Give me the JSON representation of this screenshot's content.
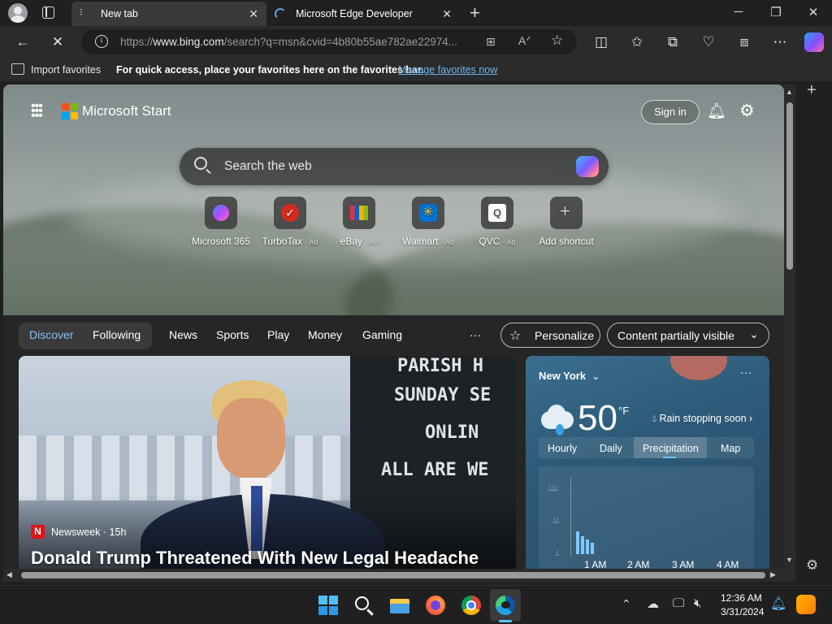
{
  "browser": {
    "tabs": [
      {
        "title": "New tab"
      },
      {
        "title": "Microsoft Edge Developer"
      }
    ],
    "address_bar": {
      "url_prefix": "https://",
      "url_domain": "www.bing.com",
      "url_rest": "/search?q=msn&cvid=4b80b55ae782",
      "url_tail": "ae22974..."
    },
    "favorites_bar": {
      "import_label": "Import favorites",
      "message": "For quick access, place your favorites here on the favorites bar.",
      "manage_link": "Manage favorites now"
    }
  },
  "page": {
    "brand": "Microsoft Start",
    "sign_in": "Sign in",
    "search_placeholder": "Search the web",
    "quick_links": [
      {
        "label": "Microsoft 365",
        "ad": ""
      },
      {
        "label": "TurboTax",
        "ad": "· Ad"
      },
      {
        "label": "eBay",
        "ad": "· Ad"
      },
      {
        "label": "Walmart",
        "ad": "· Ad"
      },
      {
        "label": "QVC",
        "ad": "· Ad"
      },
      {
        "label": "Add shortcut",
        "ad": ""
      }
    ],
    "feed_nav": {
      "discover": "Discover",
      "following": "Following",
      "items": [
        "News",
        "Sports",
        "Play",
        "Money",
        "Gaming"
      ],
      "more": "···",
      "personalize": "Personalize",
      "content_filter": "Content partially visible"
    },
    "news_card": {
      "source": "Newsweek",
      "age": "· 15h",
      "headline": "Donald Trump Threatened With New Legal Headache",
      "sign_line1": "PARISH H",
      "sign_line2": "SUNDAY SE",
      "sign_line3": "ONLIN",
      "sign_line4": "ALL ARE WE"
    },
    "weather": {
      "city": "New York",
      "temperature": "50",
      "unit": "°F",
      "condition": "Rain stopping soon",
      "tabs": [
        "Hourly",
        "Daily",
        "Precipitation",
        "Map"
      ],
      "active_tab": "Precipitation",
      "times": [
        "1 AM",
        "2 AM",
        "3 AM",
        "4 AM"
      ]
    }
  },
  "taskbar": {
    "time": "12:36 AM",
    "date": "3/31/2024"
  }
}
